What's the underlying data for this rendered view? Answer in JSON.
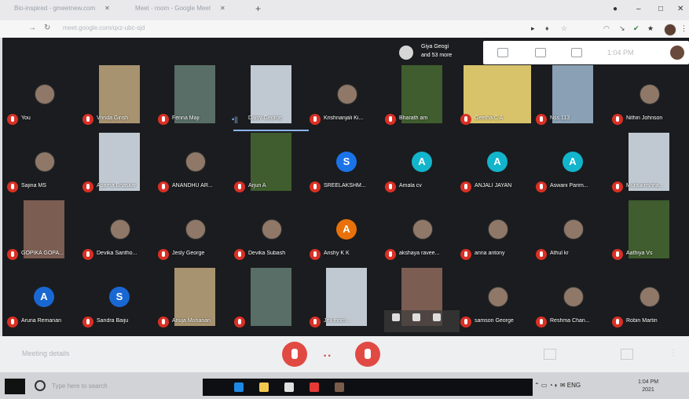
{
  "browser": {
    "tabs": [
      {
        "title": "Bio-inspired - gmeetnew.com"
      },
      {
        "title": "Meet - room - Google Meet"
      }
    ],
    "address": "meet.google.com/qxz-ubc-sjd"
  },
  "meeting": {
    "top_participant_name": "Giya Geogi",
    "top_participant_more": "and 53 more",
    "clock": "1:04 PM",
    "participants": [
      {
        "name": "You",
        "kind": "pic"
      },
      {
        "name": "Vrinda Girish",
        "kind": "video"
      },
      {
        "name": "Fenna Maji",
        "kind": "video"
      },
      {
        "name": "Daisy George",
        "kind": "video",
        "speaking": true
      },
      {
        "name": "Krishnanjali Ki...",
        "kind": "pic"
      },
      {
        "name": "Bharath am",
        "kind": "video"
      },
      {
        "name": "Geetha C A",
        "kind": "video"
      },
      {
        "name": "Nss 113",
        "kind": "video"
      },
      {
        "name": "Nithin Johnson",
        "kind": "pic"
      },
      {
        "name": "Sajina MS",
        "kind": "pic"
      },
      {
        "name": "Aparna Bhaskar",
        "kind": "video"
      },
      {
        "name": "ANANDHU AR...",
        "kind": "pic"
      },
      {
        "name": "Arjun A",
        "kind": "video"
      },
      {
        "name": "SREELAKSHM...",
        "kind": "letter",
        "letter": "S",
        "color": "#1a73e8"
      },
      {
        "name": "Amala cv",
        "kind": "letter",
        "letter": "A",
        "color": "#12b5cb"
      },
      {
        "name": "ANJALI JAYAN",
        "kind": "letter",
        "letter": "A",
        "color": "#12b5cb"
      },
      {
        "name": "Aswani Parim...",
        "kind": "letter",
        "letter": "A",
        "color": "#12b5cb"
      },
      {
        "name": "Muralikrishna...",
        "kind": "video"
      },
      {
        "name": "GOPIKA GOPA...",
        "kind": "video"
      },
      {
        "name": "Devika Santho...",
        "kind": "pic"
      },
      {
        "name": "Jesly George",
        "kind": "pic"
      },
      {
        "name": "Devika Subash",
        "kind": "pic"
      },
      {
        "name": "Anshy K K",
        "kind": "letter",
        "letter": "A",
        "color": "#e8710a"
      },
      {
        "name": "akshaya ravee...",
        "kind": "pic"
      },
      {
        "name": "anna antony",
        "kind": "pic"
      },
      {
        "name": "Athul kr",
        "kind": "pic"
      },
      {
        "name": "Aathiya Vs",
        "kind": "video"
      },
      {
        "name": "Aruna Remanan",
        "kind": "letter",
        "letter": "A",
        "color": "#1967d2"
      },
      {
        "name": "Sandra Baiju",
        "kind": "letter",
        "letter": "S",
        "color": "#1967d2"
      },
      {
        "name": "Anuja Mohanan",
        "kind": "video"
      },
      {
        "name": "",
        "kind": "video"
      },
      {
        "name": "Jeli thom...",
        "kind": "video"
      },
      {
        "name": "",
        "kind": "video",
        "hover": true
      },
      {
        "name": "samson George",
        "kind": "pic"
      },
      {
        "name": "Reshma Chan...",
        "kind": "pic"
      },
      {
        "name": "Robin Martin",
        "kind": "pic"
      }
    ]
  },
  "controls": {
    "meeting_details": "Meeting details"
  },
  "taskbar": {
    "search_placeholder": "Type here to search",
    "time": "1:04 PM",
    "date": "2021"
  },
  "colors": {
    "mute_red": "#d93025",
    "grid_bg": "#1b1c1f",
    "speaking_blue": "#8ab4f8"
  }
}
